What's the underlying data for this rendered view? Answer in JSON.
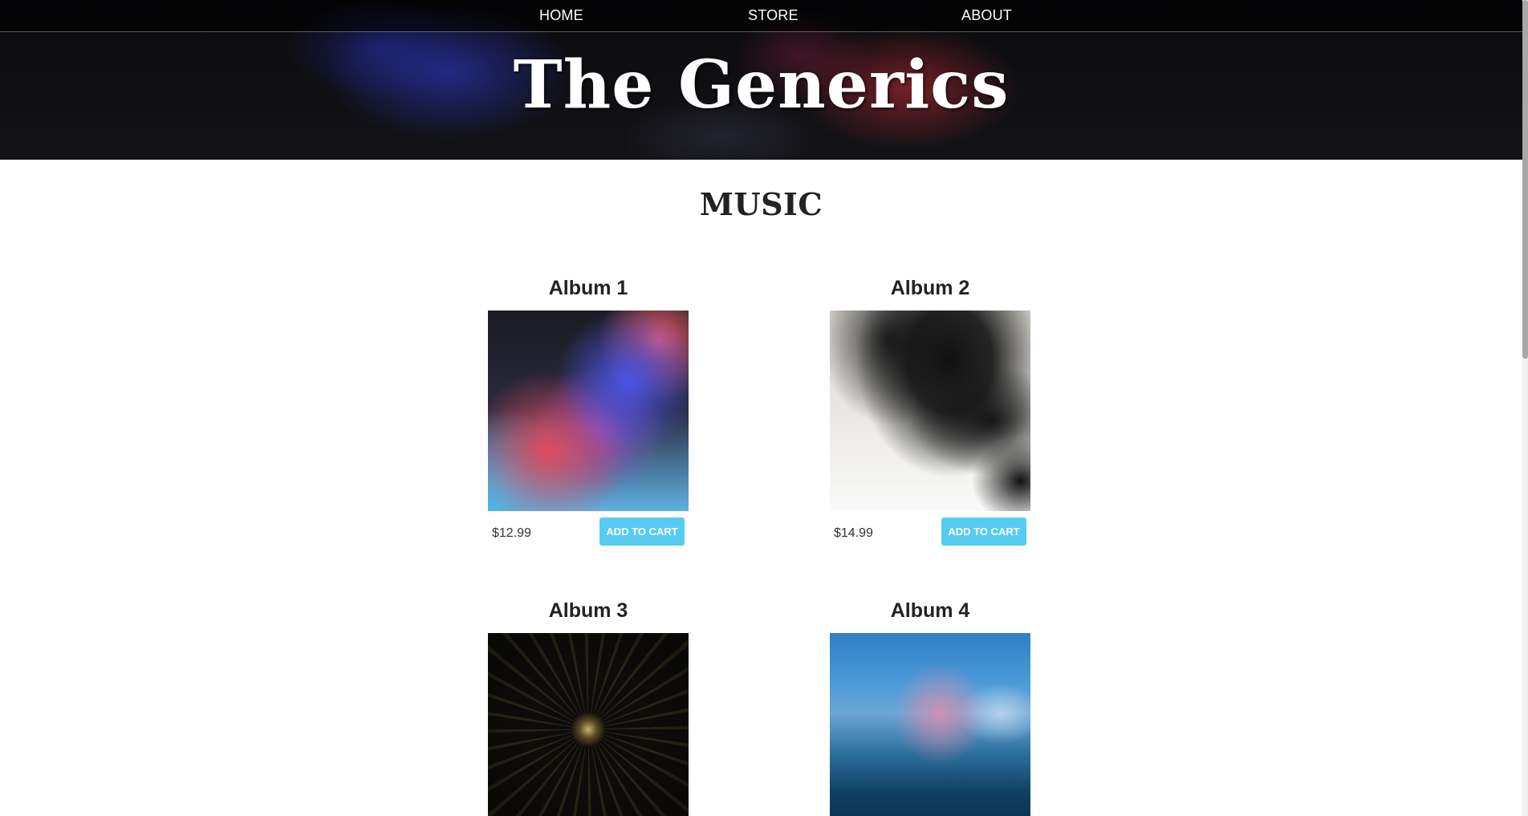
{
  "nav": {
    "home": "HOME",
    "store": "STORE",
    "about": "ABOUT"
  },
  "header": {
    "band_name": "The Generics"
  },
  "section": {
    "title": "MUSIC"
  },
  "albums": [
    {
      "title": "Album 1",
      "price": "$12.99",
      "button": "ADD TO CART"
    },
    {
      "title": "Album 2",
      "price": "$14.99",
      "button": "ADD TO CART"
    },
    {
      "title": "Album 3"
    },
    {
      "title": "Album 4"
    }
  ],
  "colors": {
    "accent": "#56ccf2",
    "header_bg": "#0b0b0e"
  },
  "scroll": {
    "position_fraction": 0
  }
}
